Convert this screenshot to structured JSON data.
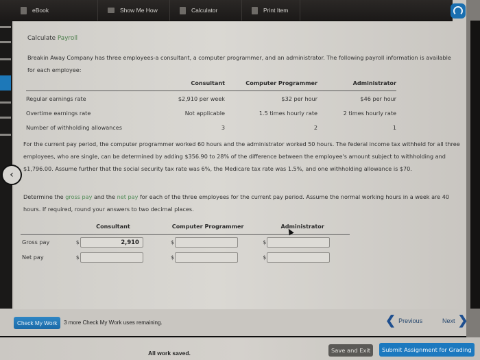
{
  "toolbar": {
    "items": [
      {
        "label": "eBook",
        "icon": "book-icon"
      },
      {
        "label": "Show Me How",
        "icon": "video-icon"
      },
      {
        "label": "Calculator",
        "icon": "calculator-icon"
      },
      {
        "label": "Print Item",
        "icon": "print-icon"
      }
    ],
    "help_icon": "headset-icon"
  },
  "heading": {
    "prefix": "Calculate",
    "highlight": "Payroll"
  },
  "intro": "Breakin Away Company has three employees-a consultant, a computer programmer, and an administrator. The following payroll information is available for each employee:",
  "info_table": {
    "headers": [
      "",
      "Consultant",
      "Computer Programmer",
      "Administrator"
    ],
    "rows": [
      [
        "Regular earnings rate",
        "$2,910 per week",
        "$32 per hour",
        "$46 per hour"
      ],
      [
        "Overtime earnings rate",
        "Not applicable",
        "1.5 times hourly rate",
        "2 times hourly rate"
      ],
      [
        "Number of withholding allowances",
        "3",
        "2",
        "1"
      ]
    ]
  },
  "scenario": "For the current pay period, the computer programmer worked 60 hours and the administrator worked 50 hours. The federal income tax withheld for all three employees, who are single, can be determined by adding $356.90 to 28% of the difference between the employee's amount subject to withholding and $1,796.00. Assume further that the social security tax rate was 6%, the Medicare tax rate was 1.5%, and one withholding allowance is $70.",
  "instructions": {
    "part1": "Determine the",
    "gross": "gross pay",
    "part2": "and the",
    "net": "net pay",
    "part3": "for each of the three employees for the current pay period. Assume the normal working hours in a week are 40 hours. If required, round your answers to two decimal places."
  },
  "answer_table": {
    "headers": [
      "",
      "Consultant",
      "Computer Programmer",
      "Administrator"
    ],
    "currency": "$",
    "rows": [
      {
        "label": "Gross pay",
        "values": [
          "2,910",
          "",
          ""
        ]
      },
      {
        "label": "Net pay",
        "values": [
          "",
          "",
          ""
        ]
      }
    ]
  },
  "check": {
    "button": "Check My Work",
    "message": "3 more Check My Work uses remaining."
  },
  "nav": {
    "previous": "Previous",
    "next": "Next"
  },
  "footer": {
    "status": "All work saved.",
    "save_exit": "Save and Exit",
    "submit": "Submit Assignment for Grading"
  },
  "colors": {
    "accent": "#1c79bf",
    "highlight_green": "#4f8a55"
  }
}
